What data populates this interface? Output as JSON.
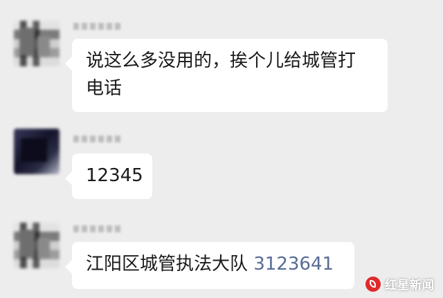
{
  "messages": [
    {
      "sender_avatar": "blurred-avatar",
      "lines": [
        "说这么多没用的，挨个儿给城管打",
        "电话"
      ]
    },
    {
      "sender_avatar": "blurred-avatar-dark",
      "lines": [
        "12345"
      ]
    },
    {
      "sender_avatar": "blurred-avatar",
      "text_prefix": "江阳区城管执法大队 ",
      "phone": "3123641"
    }
  ],
  "colors": {
    "background": "#ededed",
    "bubble": "#ffffff",
    "link": "#576b95",
    "watermark_logo": "#e02a2a"
  },
  "watermark": {
    "logo_icon": "hongxing-logo-icon",
    "text": "红星新闻"
  }
}
